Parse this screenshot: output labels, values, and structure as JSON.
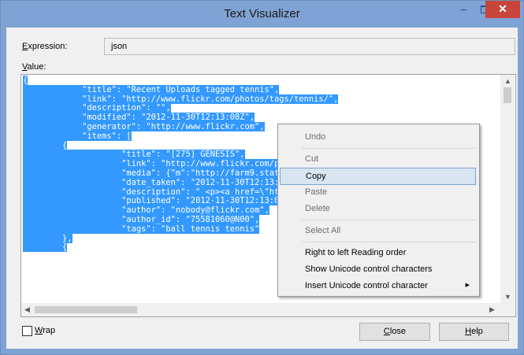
{
  "window": {
    "title": "Text Visualizer",
    "minimize_icon": "minimize-icon",
    "maximize_icon": "maximize-icon",
    "close_glyph": "✕"
  },
  "expression": {
    "label_prefix": "E",
    "label_rest": "xpression:",
    "value": "json"
  },
  "value": {
    "label_prefix": "V",
    "label_rest": "alue:"
  },
  "editor": {
    "lines": [
      "{",
      "            \"title\": \"Recent Uploads tagged tennis\",",
      "            \"link\": \"http://www.flickr.com/photos/tags/tennis/\",",
      "            \"description\": \"\",",
      "            \"modified\": \"2012-11-30T12:13:08Z\",",
      "            \"generator\": \"http://www.flickr.com\",",
      "            \"items\": [",
      "        {",
      "                    \"title\": \"[275] GÉNESIS\",",
      "                    \"link\": \"http://www.flickr.com/photos/tennis/\",",
      "                    \"media\": {\"m\":\"http://farm9.staticflickr.com/8d536\",",
      "                    \"date_taken\": \"2012-11-30T12:13:08Z\",",
      "                    \"description\": \" <p><a href=\\\"http://www.flickr.com5810\",",
      "                    \"published\": \"2012-11-30T12:13:08Z\",",
      "                    \"author\": \"nobody@flickr.com\",",
      "                    \"author_id\": \"75581060@N00\",",
      "                    \"tags\": \"ball tennis tennis\"",
      "        },",
      "        {"
    ]
  },
  "context_menu": {
    "undo": "Undo",
    "cut": "Cut",
    "copy": "Copy",
    "paste": "Paste",
    "delete": "Delete",
    "select_all": "Select All",
    "rtl": "Right to left Reading order",
    "show_unicode": "Show Unicode control characters",
    "insert_unicode": "Insert Unicode control character"
  },
  "wrap": {
    "label_prefix": "W",
    "label_rest": "rap",
    "checked": false
  },
  "buttons": {
    "close_prefix": "C",
    "close_rest": "lose",
    "help_prefix": "H",
    "help_rest": "elp"
  }
}
